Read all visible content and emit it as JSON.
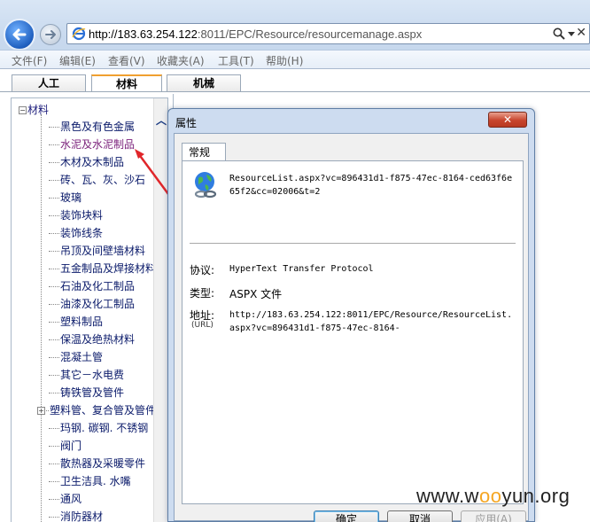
{
  "browser": {
    "url_host": "http://183.63.254.122",
    "url_rest": ":8011/EPC/Resource/resourcemanage.aspx",
    "menu": [
      "文件(F)",
      "编辑(E)",
      "查看(V)",
      "收藏夹(A)",
      "工具(T)",
      "帮助(H)"
    ]
  },
  "tabs": [
    "人工",
    "材料",
    "机械"
  ],
  "active_tab": "材料",
  "tree": {
    "root": "材料",
    "items": [
      "黑色及有色金属",
      "水泥及水泥制品",
      "木材及木制品",
      "砖、瓦、灰、沙石",
      "玻璃",
      "装饰块料",
      "装饰线条",
      "吊顶及间壁墙材料",
      "五金制品及焊接材料",
      "石油及化工制品",
      "油漆及化工制品",
      "塑料制品",
      "保温及绝热材料",
      "混凝土管",
      "其它－水电费",
      "铸铁管及管件",
      "塑料管、复合管及管件",
      "玛钢. 碳钢. 不锈钢",
      "阀门",
      "散热器及采暖零件",
      "卫生洁具. 水嘴",
      "通风",
      "消防器材"
    ]
  },
  "dialog": {
    "title": "属性",
    "close": "✕",
    "tab": "常规",
    "file_name": "ResourceList.aspx?vc=896431d1-f875-47ec-8164-ced63f6e65f2&cc=02006&t=2",
    "protocol_label": "协议:",
    "protocol_value": "HyperText Transfer Protocol",
    "type_label": "类型:",
    "type_value": "ASPX 文件",
    "address_label": "地址:",
    "address_sub": "(URL)",
    "address_value": "http://183.63.254.122:8011/EPC/Resource/ResourceList.aspx?vc=896431d1-f875-47ec-8164-",
    "ok": "确定",
    "cancel": "取消",
    "apply": "应用(A)"
  },
  "watermark": {
    "pre": "www.w",
    "oo": "oo",
    "post": "yun.org"
  }
}
